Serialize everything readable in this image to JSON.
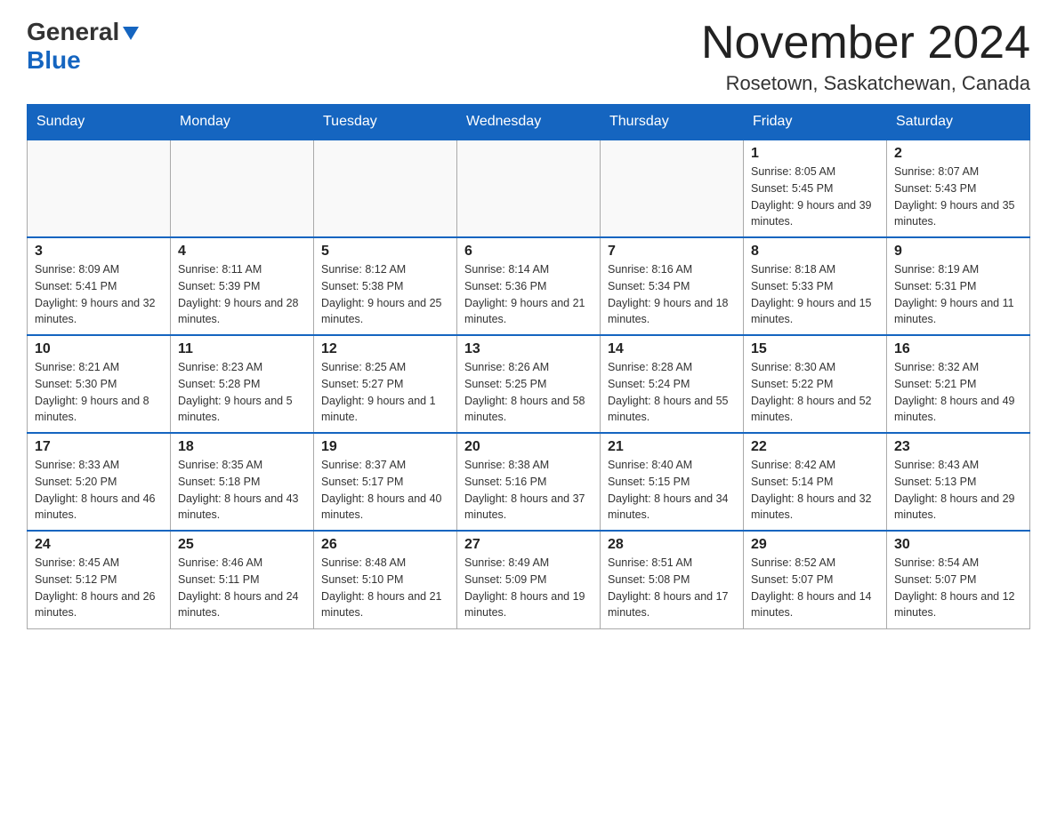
{
  "header": {
    "title": "November 2024",
    "subtitle": "Rosetown, Saskatchewan, Canada"
  },
  "logo": {
    "line1": "General",
    "line2": "Blue"
  },
  "weekdays": [
    "Sunday",
    "Monday",
    "Tuesday",
    "Wednesday",
    "Thursday",
    "Friday",
    "Saturday"
  ],
  "weeks": [
    [
      {
        "day": "",
        "info": ""
      },
      {
        "day": "",
        "info": ""
      },
      {
        "day": "",
        "info": ""
      },
      {
        "day": "",
        "info": ""
      },
      {
        "day": "",
        "info": ""
      },
      {
        "day": "1",
        "info": "Sunrise: 8:05 AM\nSunset: 5:45 PM\nDaylight: 9 hours and 39 minutes."
      },
      {
        "day": "2",
        "info": "Sunrise: 8:07 AM\nSunset: 5:43 PM\nDaylight: 9 hours and 35 minutes."
      }
    ],
    [
      {
        "day": "3",
        "info": "Sunrise: 8:09 AM\nSunset: 5:41 PM\nDaylight: 9 hours and 32 minutes."
      },
      {
        "day": "4",
        "info": "Sunrise: 8:11 AM\nSunset: 5:39 PM\nDaylight: 9 hours and 28 minutes."
      },
      {
        "day": "5",
        "info": "Sunrise: 8:12 AM\nSunset: 5:38 PM\nDaylight: 9 hours and 25 minutes."
      },
      {
        "day": "6",
        "info": "Sunrise: 8:14 AM\nSunset: 5:36 PM\nDaylight: 9 hours and 21 minutes."
      },
      {
        "day": "7",
        "info": "Sunrise: 8:16 AM\nSunset: 5:34 PM\nDaylight: 9 hours and 18 minutes."
      },
      {
        "day": "8",
        "info": "Sunrise: 8:18 AM\nSunset: 5:33 PM\nDaylight: 9 hours and 15 minutes."
      },
      {
        "day": "9",
        "info": "Sunrise: 8:19 AM\nSunset: 5:31 PM\nDaylight: 9 hours and 11 minutes."
      }
    ],
    [
      {
        "day": "10",
        "info": "Sunrise: 8:21 AM\nSunset: 5:30 PM\nDaylight: 9 hours and 8 minutes."
      },
      {
        "day": "11",
        "info": "Sunrise: 8:23 AM\nSunset: 5:28 PM\nDaylight: 9 hours and 5 minutes."
      },
      {
        "day": "12",
        "info": "Sunrise: 8:25 AM\nSunset: 5:27 PM\nDaylight: 9 hours and 1 minute."
      },
      {
        "day": "13",
        "info": "Sunrise: 8:26 AM\nSunset: 5:25 PM\nDaylight: 8 hours and 58 minutes."
      },
      {
        "day": "14",
        "info": "Sunrise: 8:28 AM\nSunset: 5:24 PM\nDaylight: 8 hours and 55 minutes."
      },
      {
        "day": "15",
        "info": "Sunrise: 8:30 AM\nSunset: 5:22 PM\nDaylight: 8 hours and 52 minutes."
      },
      {
        "day": "16",
        "info": "Sunrise: 8:32 AM\nSunset: 5:21 PM\nDaylight: 8 hours and 49 minutes."
      }
    ],
    [
      {
        "day": "17",
        "info": "Sunrise: 8:33 AM\nSunset: 5:20 PM\nDaylight: 8 hours and 46 minutes."
      },
      {
        "day": "18",
        "info": "Sunrise: 8:35 AM\nSunset: 5:18 PM\nDaylight: 8 hours and 43 minutes."
      },
      {
        "day": "19",
        "info": "Sunrise: 8:37 AM\nSunset: 5:17 PM\nDaylight: 8 hours and 40 minutes."
      },
      {
        "day": "20",
        "info": "Sunrise: 8:38 AM\nSunset: 5:16 PM\nDaylight: 8 hours and 37 minutes."
      },
      {
        "day": "21",
        "info": "Sunrise: 8:40 AM\nSunset: 5:15 PM\nDaylight: 8 hours and 34 minutes."
      },
      {
        "day": "22",
        "info": "Sunrise: 8:42 AM\nSunset: 5:14 PM\nDaylight: 8 hours and 32 minutes."
      },
      {
        "day": "23",
        "info": "Sunrise: 8:43 AM\nSunset: 5:13 PM\nDaylight: 8 hours and 29 minutes."
      }
    ],
    [
      {
        "day": "24",
        "info": "Sunrise: 8:45 AM\nSunset: 5:12 PM\nDaylight: 8 hours and 26 minutes."
      },
      {
        "day": "25",
        "info": "Sunrise: 8:46 AM\nSunset: 5:11 PM\nDaylight: 8 hours and 24 minutes."
      },
      {
        "day": "26",
        "info": "Sunrise: 8:48 AM\nSunset: 5:10 PM\nDaylight: 8 hours and 21 minutes."
      },
      {
        "day": "27",
        "info": "Sunrise: 8:49 AM\nSunset: 5:09 PM\nDaylight: 8 hours and 19 minutes."
      },
      {
        "day": "28",
        "info": "Sunrise: 8:51 AM\nSunset: 5:08 PM\nDaylight: 8 hours and 17 minutes."
      },
      {
        "day": "29",
        "info": "Sunrise: 8:52 AM\nSunset: 5:07 PM\nDaylight: 8 hours and 14 minutes."
      },
      {
        "day": "30",
        "info": "Sunrise: 8:54 AM\nSunset: 5:07 PM\nDaylight: 8 hours and 12 minutes."
      }
    ]
  ]
}
